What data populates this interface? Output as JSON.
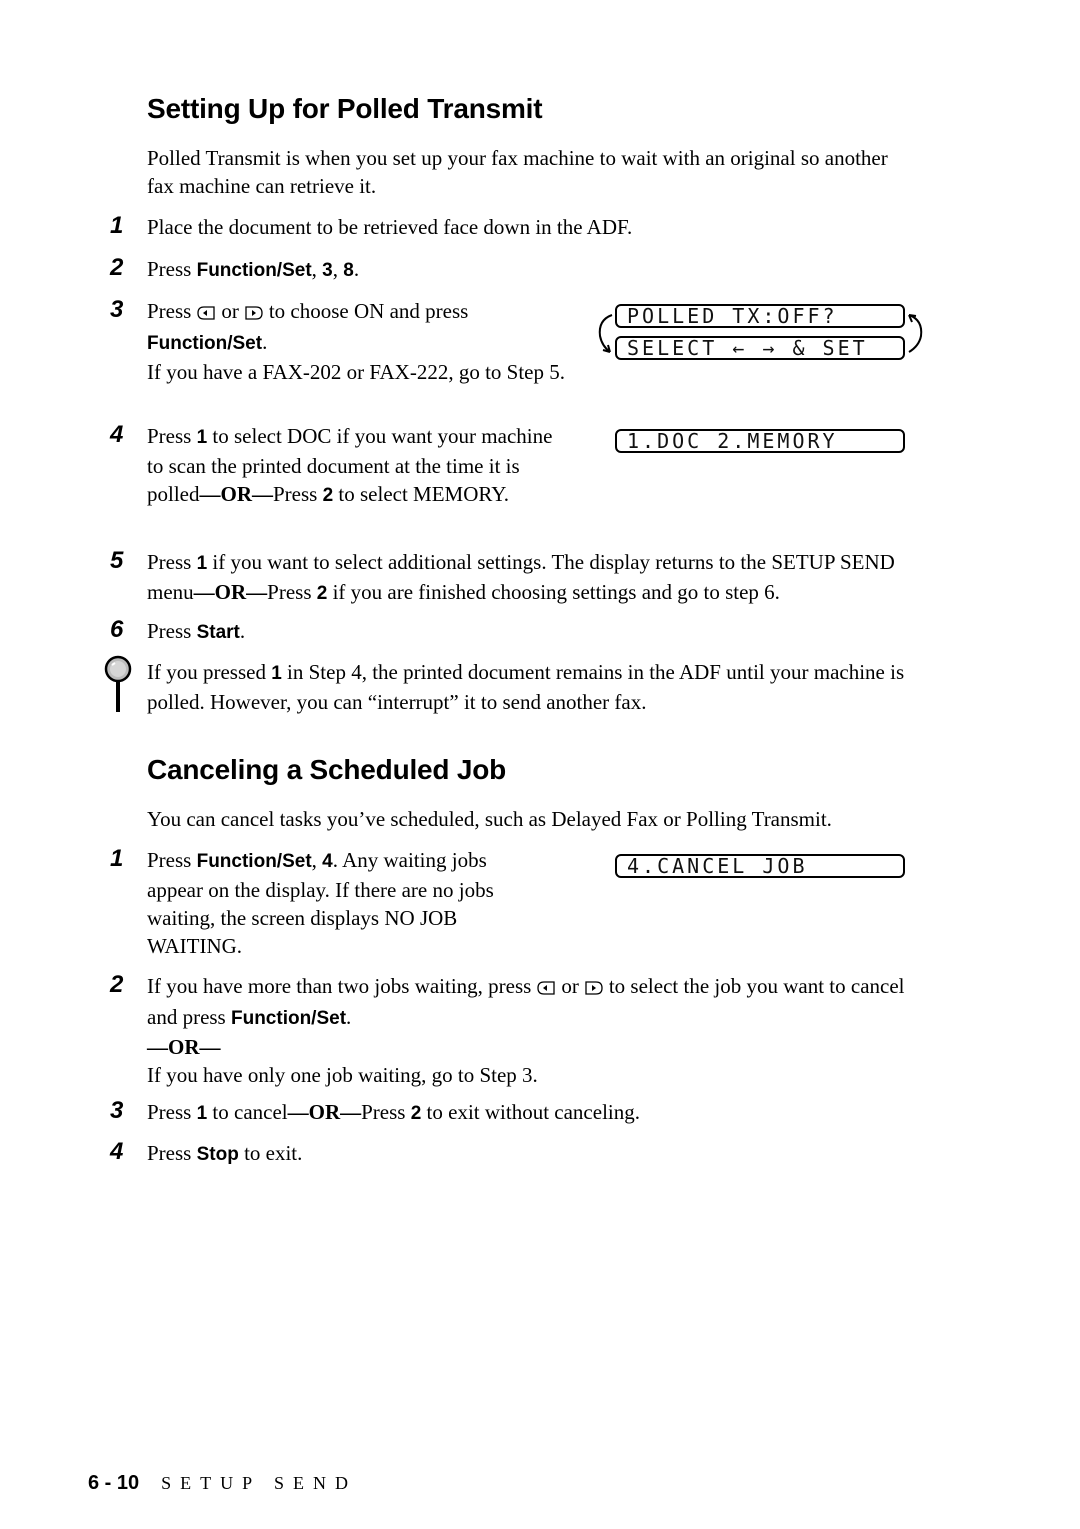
{
  "section1": {
    "title": "Setting Up for Polled Transmit",
    "intro": "Polled Transmit is when you set up your fax machine to wait with an original so another fax machine can retrieve it.",
    "steps": [
      {
        "num": "1",
        "text": "Place the document to be retrieved face down in the ADF."
      },
      {
        "num": "2",
        "pre": "Press ",
        "key": "Function/Set",
        "mid": ", ",
        "k2": "3",
        "sep": ", ",
        "k3": "8",
        "post": "."
      },
      {
        "num": "3",
        "pre": "Press",
        "or": "or",
        "mid": "to choose ON and press",
        "key": "Function/Set",
        "post": ".",
        "note": "If you have a FAX-202 or FAX-222, go to Step 5."
      },
      {
        "num": "4",
        "pre": "Press ",
        "k1": "1",
        "mid": " to select DOC if you want your machine to scan the printed document at the time it is polled",
        "or": "—OR—",
        "mid2": "Press ",
        "k2": "2",
        "post": " to select MEMORY."
      },
      {
        "num": "5",
        "pre": "Press ",
        "k1": "1",
        "mid": " if you want to select additional settings. The display returns to the SETUP SEND menu",
        "or": "—OR—",
        "mid2": "Press ",
        "k2": "2",
        "post": " if you are finished choosing settings and go to step 6."
      },
      {
        "num": "6",
        "pre": "Press ",
        "key": "Start",
        "post": "."
      }
    ],
    "tip": {
      "pre": "If you pressed ",
      "k1": "1",
      "post": " in Step 4, the printed document remains in the ADF until your machine is polled.  However, you can “interrupt” it to send another fax."
    },
    "lcd": {
      "line1": "POLLED TX:OFF?",
      "line2": "SELECT ← → & SET",
      "line3": "1.DOC 2.MEMORY"
    }
  },
  "section2": {
    "title": "Canceling a Scheduled Job",
    "intro": "You can cancel tasks you’ve scheduled, such as Delayed Fax or Polling Transmit.",
    "steps": [
      {
        "num": "1",
        "pre": "Press ",
        "key": "Function/Set",
        "sep": ", ",
        "k2": "4",
        "post": ". Any waiting jobs appear on the display. If there are no jobs waiting, the screen displays NO JOB WAITING."
      },
      {
        "num": "2",
        "pre": "If you have more than two jobs waiting, press",
        "or": "or",
        "mid": "to select the job you want to cancel and press ",
        "key": "Function/Set",
        "post": ".",
        "or_line": "—OR—",
        "alt": "If you have only one job waiting, go to Step 3."
      },
      {
        "num": "3",
        "pre": "Press ",
        "k1": "1",
        "mid": " to cancel",
        "or": "—OR—",
        "mid2": "Press ",
        "k2": "2",
        "post": " to exit without canceling."
      },
      {
        "num": "4",
        "pre": "Press ",
        "key": "Stop",
        "post": " to exit."
      }
    ],
    "lcd": {
      "line1": "4.CANCEL JOB"
    }
  },
  "footer": {
    "page": "6 - 10",
    "section": "SETUP SEND"
  }
}
